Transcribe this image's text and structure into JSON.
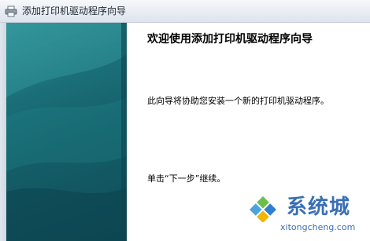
{
  "window": {
    "title": "添加打印机驱动程序向导"
  },
  "content": {
    "heading": "欢迎使用添加打印机驱动程序向导",
    "description": "此向导将协助您安装一个新的打印机驱动程序。",
    "instruction": "单击“下一步”继续。"
  },
  "watermark": {
    "brand": "系统城",
    "url": "xitongcheng.com"
  },
  "colors": {
    "sidebar_top": "#2c8f95",
    "sidebar_bottom": "#0e4d58",
    "watermark": "#3a6fb5"
  },
  "icons": {
    "title_icon": "printer-icon",
    "watermark_logo": "windows-logo-icon"
  }
}
